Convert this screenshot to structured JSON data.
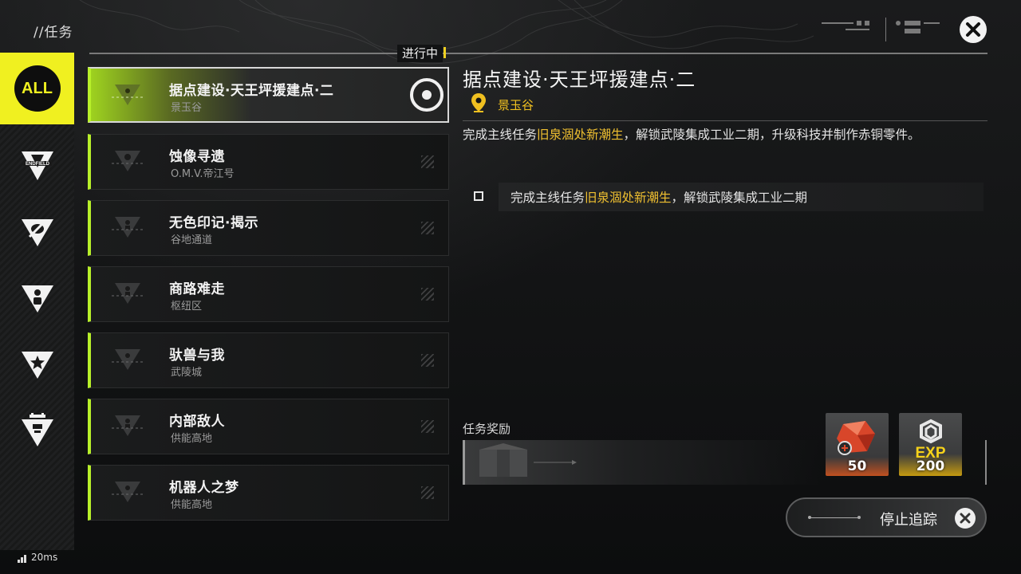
{
  "header": {
    "breadcrumb": "//任务",
    "close_icon": "close-icon"
  },
  "sidebar": {
    "items": [
      {
        "label": "ALL",
        "icon": "all-icon",
        "selected": true
      },
      {
        "label": "ENDFIELD",
        "icon": "endfield-icon"
      },
      {
        "label": "",
        "icon": "eye-slash-icon"
      },
      {
        "label": "",
        "icon": "person-icon"
      },
      {
        "label": "",
        "icon": "star-icon"
      },
      {
        "label": "",
        "icon": "gate-icon"
      }
    ]
  },
  "list": {
    "status_tag": "进行中",
    "quests": [
      {
        "title": "据点建设·天王坪援建点·二",
        "location": "景玉谷",
        "active": true,
        "tracked": true
      },
      {
        "title": "蚀像寻遗",
        "location": "O.M.V.帝江号"
      },
      {
        "title": "无色印记·揭示",
        "location": "谷地通道"
      },
      {
        "title": "商路难走",
        "location": "枢纽区"
      },
      {
        "title": "驮兽与我",
        "location": "武陵城"
      },
      {
        "title": "内部敌人",
        "location": "供能高地"
      },
      {
        "title": "机器人之梦",
        "location": "供能高地"
      }
    ]
  },
  "detail": {
    "title": "据点建设·天王坪援建点·二",
    "location": "景玉谷",
    "desc_before": "完成主线任务",
    "desc_highlight": "旧泉涸处新潮生",
    "desc_after": "，解锁武陵集成工业二期，升级科技并制作赤铜零件。",
    "objective_before": "完成主线任务",
    "objective_highlight": "旧泉涸处新潮生",
    "objective_after": "，解锁武陵集成工业二期",
    "rewards_label": "任务奖励",
    "rewards": [
      {
        "icon": "crystal-icon",
        "qty": "50"
      },
      {
        "icon": "exp-icon",
        "label": "EXP",
        "qty": "200"
      }
    ],
    "stop_tracking_label": "停止追踪"
  },
  "status": {
    "ping": "20ms"
  },
  "colors": {
    "accent": "#b8f02a",
    "yellow": "#f0f020",
    "highlight": "#f0c030"
  }
}
